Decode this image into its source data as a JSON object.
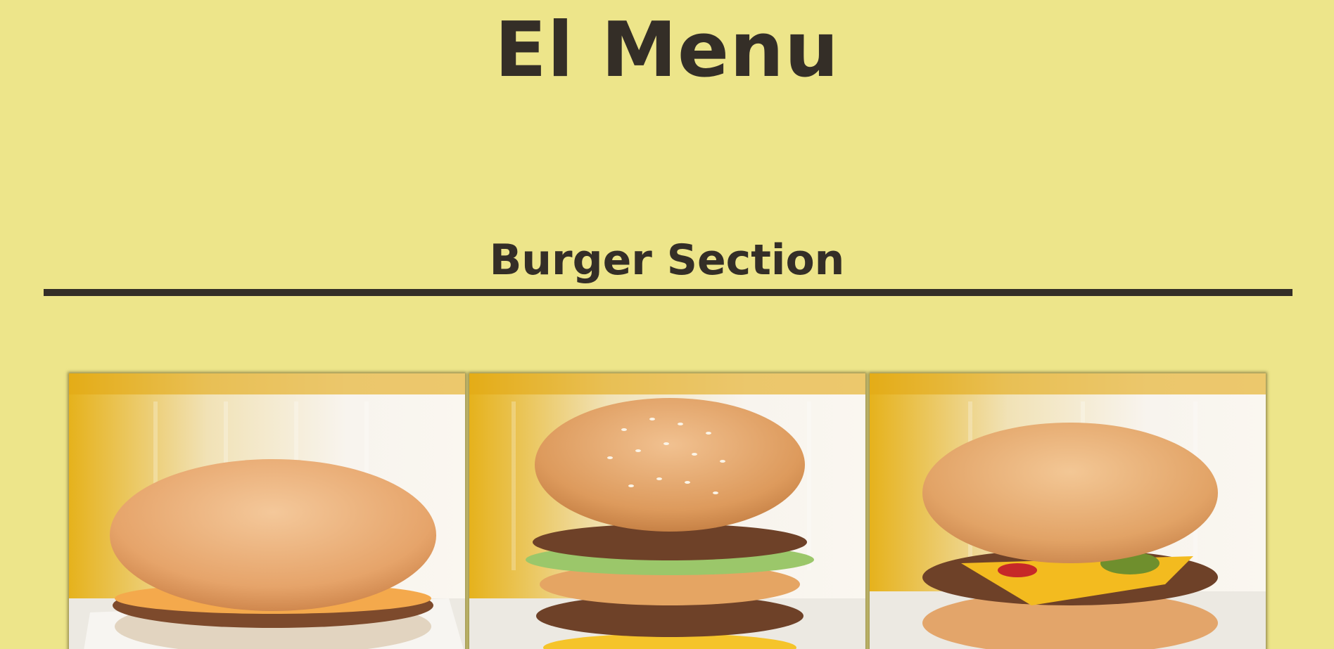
{
  "page": {
    "title": "El Menu",
    "background_color": "#ede58a",
    "text_color": "#342e27"
  },
  "section": {
    "title": "Burger Section"
  },
  "gallery": {
    "items": [
      {
        "image_icon": "hamburger-image"
      },
      {
        "image_icon": "big-mac-image"
      },
      {
        "image_icon": "cheeseburger-image"
      }
    ]
  }
}
